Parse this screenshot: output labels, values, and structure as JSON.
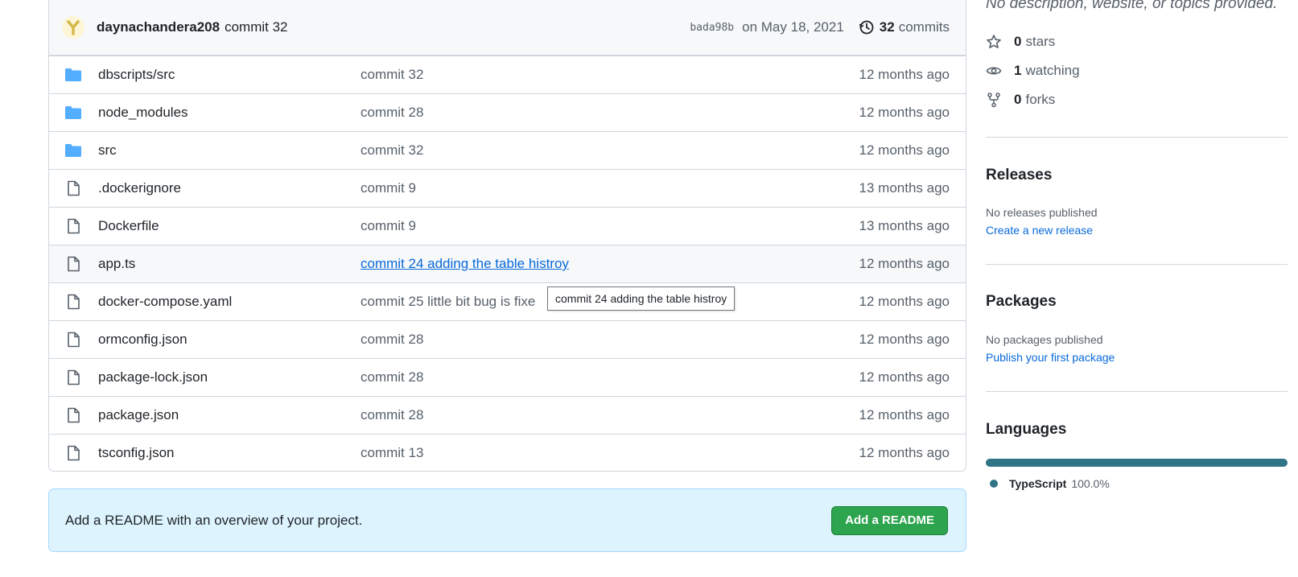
{
  "commit": {
    "author": "daynachandera208",
    "message": "commit 32",
    "sha": "bada98b",
    "date": "on May 18, 2021",
    "count": "32",
    "count_label": "commits"
  },
  "files": [
    {
      "name": "dbscripts/src",
      "type": "folder",
      "message": "commit 32",
      "age": "12 months ago"
    },
    {
      "name": "node_modules",
      "type": "folder",
      "message": "commit 28",
      "age": "12 months ago"
    },
    {
      "name": "src",
      "type": "folder",
      "message": "commit 32",
      "age": "12 months ago"
    },
    {
      "name": ".dockerignore",
      "type": "file",
      "message": "commit 9",
      "age": "13 months ago"
    },
    {
      "name": "Dockerfile",
      "type": "file",
      "message": "commit 9",
      "age": "13 months ago"
    },
    {
      "name": "app.ts",
      "type": "file",
      "message": "commit 24 adding the table histroy",
      "age": "12 months ago"
    },
    {
      "name": "docker-compose.yaml",
      "type": "file",
      "message": "commit 25 little bit bug is fixe",
      "age": "12 months ago"
    },
    {
      "name": "ormconfig.json",
      "type": "file",
      "message": "commit 28",
      "age": "12 months ago"
    },
    {
      "name": "package-lock.json",
      "type": "file",
      "message": "commit 28",
      "age": "12 months ago"
    },
    {
      "name": "package.json",
      "type": "file",
      "message": "commit 28",
      "age": "12 months ago"
    },
    {
      "name": "tsconfig.json",
      "type": "file",
      "message": "commit 13",
      "age": "12 months ago"
    }
  ],
  "tooltip": "commit 24 adding the table histroy",
  "readme": {
    "text": "Add a README with an overview of your project.",
    "button": "Add a README"
  },
  "sidebar": {
    "about": "No description, website, or topics provided.",
    "stars_count": "0",
    "stars_label": "stars",
    "watching_count": "1",
    "watching_label": "watching",
    "forks_count": "0",
    "forks_label": "forks",
    "releases_title": "Releases",
    "releases_text": "No releases published",
    "releases_link": "Create a new release",
    "packages_title": "Packages",
    "packages_text": "No packages published",
    "packages_link": "Publish your first package",
    "languages_title": "Languages",
    "language_name": "TypeScript",
    "language_pct": "100.0%",
    "language_share": 1.0,
    "language_color": "#2f7487"
  },
  "colors": {
    "folder": "#54aeff",
    "link": "#0969da",
    "accent_green": "#2da44e"
  }
}
